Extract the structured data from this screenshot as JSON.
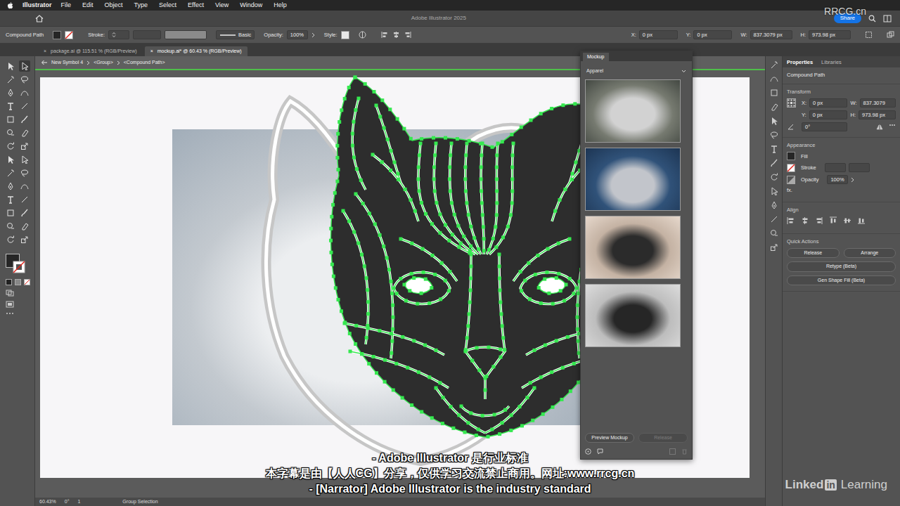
{
  "menubar": {
    "app": "Illustrator",
    "items": [
      "File",
      "Edit",
      "Object",
      "Type",
      "Select",
      "Effect",
      "View",
      "Window",
      "Help"
    ]
  },
  "titlebar": {
    "title": "Adobe Illustrator 2025",
    "share": "Share"
  },
  "watermark": {
    "site": "RRCG.cn",
    "caption": "本字幕是由【人人CG】分享，仅供学习交流禁止商用。网址:www.rrcg.cn"
  },
  "control_bar": {
    "selection": "Compound Path",
    "stroke_label": "Stroke:",
    "brush": "Basic",
    "opacity_label": "Opacity:",
    "opacity": "100%",
    "style_label": "Style:",
    "x_label": "X:",
    "x": "0 px",
    "y_label": "Y:",
    "y": "0 px",
    "w_label": "W:",
    "w": "837.3079 px",
    "h_label": "H:",
    "h": "973.98 px"
  },
  "doc_tabs": [
    {
      "label": "package.ai @ 115.51 % (RGB/Preview)",
      "close": "×",
      "selected": false
    },
    {
      "label": "mockup.ai* @ 60.43 % (RGB/Preview)",
      "close": "×",
      "selected": true
    }
  ],
  "breadcrumb": [
    "New Symbol 4",
    "<Group>",
    "<Compound Path>"
  ],
  "tools": [
    {
      "selected": false
    },
    {
      "selected": true
    },
    {
      "selected": false
    },
    {
      "selected": false
    },
    {
      "selected": false
    },
    {
      "selected": false
    },
    {
      "selected": false
    },
    {
      "selected": false
    },
    {
      "selected": false
    },
    {
      "selected": false
    },
    {
      "selected": false
    },
    {
      "selected": false
    },
    {
      "selected": false
    },
    {
      "selected": false
    },
    {
      "selected": false
    },
    {
      "selected": false
    },
    {
      "selected": false
    },
    {
      "selected": false
    },
    {
      "selected": false
    },
    {
      "selected": false
    },
    {
      "selected": false
    },
    {
      "selected": false
    },
    {
      "selected": false
    },
    {
      "selected": false
    },
    {
      "selected": false
    },
    {
      "selected": false
    },
    {
      "selected": false
    },
    {
      "selected": false
    }
  ],
  "mockup_panel": {
    "title": "Mockup",
    "category": "Apparel",
    "templates": [
      {
        "kind": "cap"
      },
      {
        "kind": "hoodie"
      },
      {
        "kind": "tshirt"
      },
      {
        "kind": "trucker"
      }
    ],
    "buttons": [
      {
        "label": "Preview Mockup",
        "disabled": false
      },
      {
        "label": "Release",
        "disabled": true
      }
    ]
  },
  "properties": {
    "tabs": [
      {
        "label": "Properties",
        "selected": true
      },
      {
        "label": "Libraries",
        "selected": false
      }
    ],
    "selection": "Compound Path",
    "transform": {
      "title": "Transform",
      "x_label": "X:",
      "x": "0 px",
      "y_label": "Y:",
      "y": "0 px",
      "w_label": "W:",
      "w": "837.3079",
      "h_label": "H:",
      "h": "973.98 px",
      "angle": "0°"
    },
    "appearance": {
      "title": "Appearance",
      "fill": "Fill",
      "stroke": "Stroke",
      "opacity": "Opacity",
      "opacity_value": "100%",
      "fx": "fx."
    },
    "align": {
      "title": "Align"
    },
    "quick_actions": {
      "title": "Quick Actions",
      "buttons": [
        "Release",
        "Arrange",
        "Retype (Beta)",
        "Gen Shape Fill (Beta)"
      ]
    }
  },
  "status_bar": {
    "zoom": "60.43%",
    "rotation": "0°",
    "artboard": "1",
    "tool": "Group Selection"
  },
  "subtitles": [
    "- Adobe Illustrator 是行业标准",
    "- [Narrator] Adobe Illustrator is the industry standard"
  ],
  "branding": {
    "linked": "Linked",
    "in": "in",
    "learning": "Learning"
  }
}
